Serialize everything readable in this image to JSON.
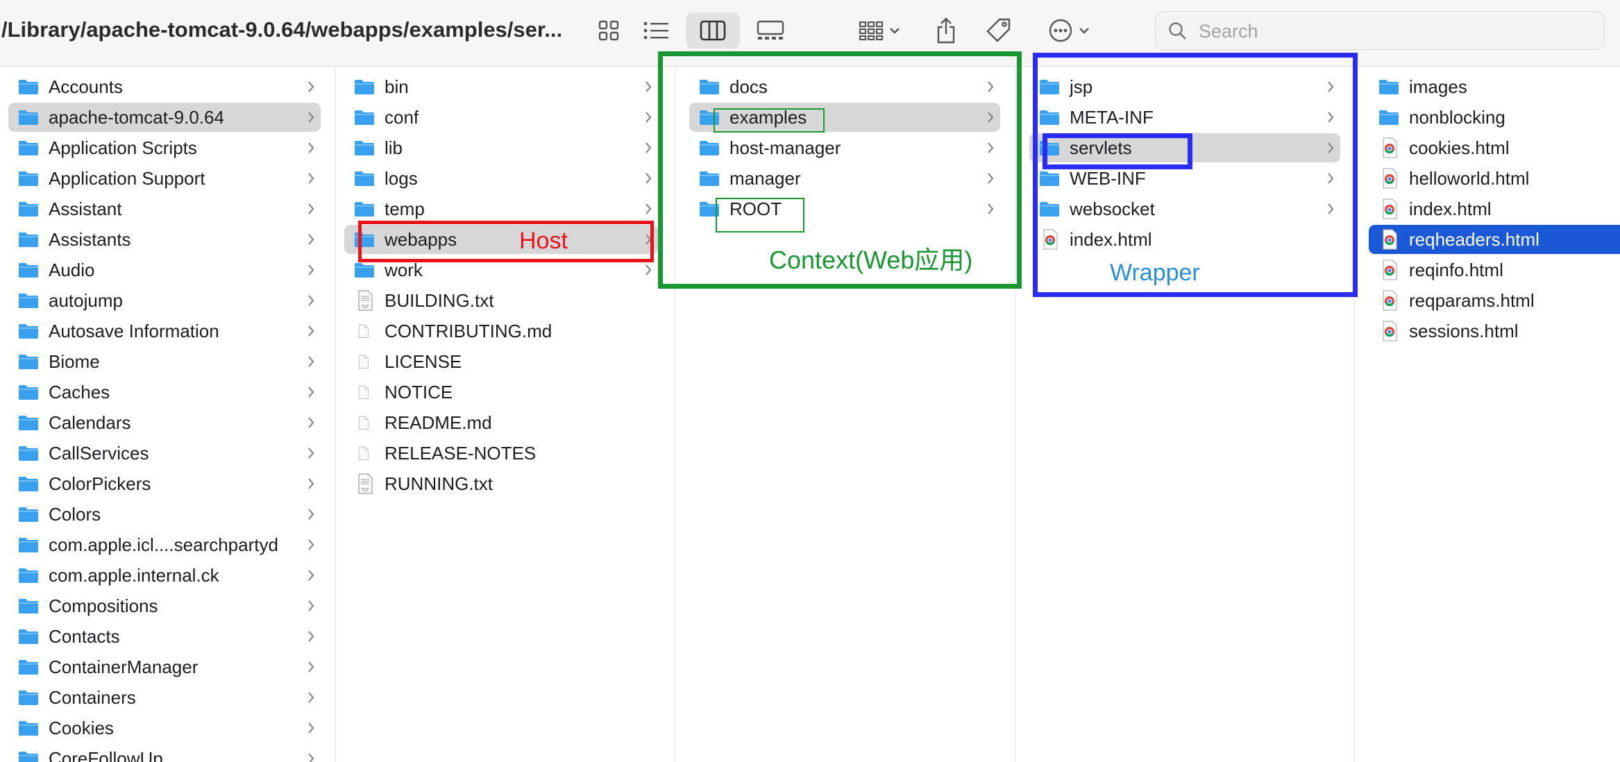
{
  "window": {
    "path_title": "/Library/apache-tomcat-9.0.64/webapps/examples/ser...",
    "search_placeholder": "Search"
  },
  "toolbar": {
    "view_buttons": [
      "grid-view-icon",
      "list-view-icon",
      "column-view-icon",
      "gallery-view-icon"
    ],
    "active_view": "column-view-icon",
    "actions": [
      "group-icon",
      "share-icon",
      "tag-icon",
      "more-icon"
    ]
  },
  "columns": [
    {
      "items": [
        {
          "label": "Accounts",
          "type": "folder",
          "chevron": true
        },
        {
          "label": "apache-tomcat-9.0.64",
          "type": "folder",
          "chevron": true,
          "selected": "gray"
        },
        {
          "label": "Application Scripts",
          "type": "folder",
          "chevron": true
        },
        {
          "label": "Application Support",
          "type": "folder",
          "chevron": true
        },
        {
          "label": "Assistant",
          "type": "folder",
          "chevron": true
        },
        {
          "label": "Assistants",
          "type": "folder",
          "chevron": true
        },
        {
          "label": "Audio",
          "type": "folder",
          "chevron": true
        },
        {
          "label": "autojump",
          "type": "folder",
          "chevron": true
        },
        {
          "label": "Autosave Information",
          "type": "folder",
          "chevron": true
        },
        {
          "label": "Biome",
          "type": "folder",
          "chevron": true
        },
        {
          "label": "Caches",
          "type": "folder",
          "chevron": true
        },
        {
          "label": "Calendars",
          "type": "folder",
          "chevron": true
        },
        {
          "label": "CallServices",
          "type": "folder",
          "chevron": true
        },
        {
          "label": "ColorPickers",
          "type": "folder",
          "chevron": true
        },
        {
          "label": "Colors",
          "type": "folder",
          "chevron": true
        },
        {
          "label": "com.apple.icl....searchpartyd",
          "type": "folder",
          "chevron": true
        },
        {
          "label": "com.apple.internal.ck",
          "type": "folder",
          "chevron": true
        },
        {
          "label": "Compositions",
          "type": "folder",
          "chevron": true
        },
        {
          "label": "Contacts",
          "type": "folder",
          "chevron": true
        },
        {
          "label": "ContainerManager",
          "type": "folder",
          "chevron": true
        },
        {
          "label": "Containers",
          "type": "folder",
          "chevron": true
        },
        {
          "label": "Cookies",
          "type": "folder",
          "chevron": true
        },
        {
          "label": "CoreFollowUp",
          "type": "folder",
          "chevron": true
        }
      ]
    },
    {
      "items": [
        {
          "label": "bin",
          "type": "folder",
          "chevron": true
        },
        {
          "label": "conf",
          "type": "folder",
          "chevron": true
        },
        {
          "label": "lib",
          "type": "folder",
          "chevron": true
        },
        {
          "label": "logs",
          "type": "folder",
          "chevron": true
        },
        {
          "label": "temp",
          "type": "folder",
          "chevron": true
        },
        {
          "label": "webapps",
          "type": "folder",
          "chevron": true,
          "selected": "gray"
        },
        {
          "label": "work",
          "type": "folder",
          "chevron": true
        },
        {
          "label": "BUILDING.txt",
          "type": "txt"
        },
        {
          "label": "CONTRIBUTING.md",
          "type": "doc"
        },
        {
          "label": "LICENSE",
          "type": "doc"
        },
        {
          "label": "NOTICE",
          "type": "doc"
        },
        {
          "label": "README.md",
          "type": "doc"
        },
        {
          "label": "RELEASE-NOTES",
          "type": "doc"
        },
        {
          "label": "RUNNING.txt",
          "type": "txt"
        }
      ]
    },
    {
      "items": [
        {
          "label": "docs",
          "type": "folder",
          "chevron": true
        },
        {
          "label": "examples",
          "type": "folder",
          "chevron": true,
          "selected": "gray"
        },
        {
          "label": "host-manager",
          "type": "folder",
          "chevron": true
        },
        {
          "label": "manager",
          "type": "folder",
          "chevron": true
        },
        {
          "label": "ROOT",
          "type": "folder",
          "chevron": true
        }
      ]
    },
    {
      "items": [
        {
          "label": "jsp",
          "type": "folder",
          "chevron": true
        },
        {
          "label": "META-INF",
          "type": "folder",
          "chevron": true
        },
        {
          "label": "servlets",
          "type": "folder",
          "chevron": true,
          "selected": "gray"
        },
        {
          "label": "WEB-INF",
          "type": "folder",
          "chevron": true
        },
        {
          "label": "websocket",
          "type": "folder",
          "chevron": true
        },
        {
          "label": "index.html",
          "type": "html"
        }
      ]
    },
    {
      "items": [
        {
          "label": "images",
          "type": "folder"
        },
        {
          "label": "nonblocking",
          "type": "folder"
        },
        {
          "label": "cookies.html",
          "type": "html"
        },
        {
          "label": "helloworld.html",
          "type": "html"
        },
        {
          "label": "index.html",
          "type": "html"
        },
        {
          "label": "reqheaders.html",
          "type": "html",
          "selected": "blue"
        },
        {
          "label": "reqinfo.html",
          "type": "html"
        },
        {
          "label": "reqparams.html",
          "type": "html"
        },
        {
          "label": "sessions.html",
          "type": "html"
        }
      ]
    }
  ],
  "annotations": {
    "host": {
      "text": "Host",
      "color": "#e8131b"
    },
    "context": {
      "text": "Context(Web应用)",
      "color": "#1a9632"
    },
    "wrapper": {
      "text": "Wrapper",
      "color": "#2a8fd6"
    },
    "wrapper_box_color": "#2b2cf2"
  },
  "colors": {
    "folder": "#3aa0ee",
    "selection_gray": "#d7d7d7",
    "selection_blue": "#1b58d6"
  }
}
